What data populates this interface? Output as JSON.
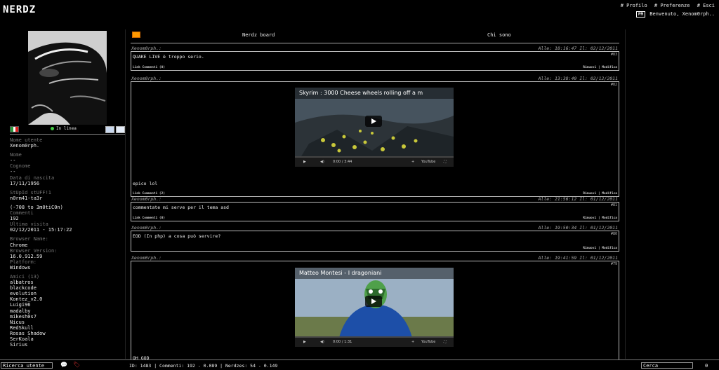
{
  "app": {
    "logo": "NERDZ"
  },
  "topnav": {
    "profilo": "# Profilo",
    "preferenze": "# Preferenze",
    "esci": "# Esci"
  },
  "welcome": {
    "pm_icon": "PM",
    "text": "Benvenuto, Xenom0rph.."
  },
  "sidebar": {
    "online": "In linea",
    "fields": [
      {
        "label": "Nome utente",
        "value": "Xenom0rph."
      },
      {
        "label": "Nome",
        "value": "--"
      },
      {
        "label": "Cognome",
        "value": "--"
      },
      {
        "label": "Data di nascita",
        "value": "17/11/1956"
      },
      {
        "label": "StUpId stUFF!1",
        "value": "n0rm41-ta3r"
      },
      {
        "label": "",
        "value": "(-708 to 3m0tiC0n)"
      },
      {
        "label": "Commenti",
        "value": "192"
      },
      {
        "label": "Ultima visita",
        "value": "02/12/2011 - 15:17:22"
      },
      {
        "label": "Browser Name:",
        "value": "Chrome"
      },
      {
        "label": "Browser Version:",
        "value": "16.0.912.59"
      },
      {
        "label": "Platform:",
        "value": "Windows"
      }
    ],
    "friends_label": "Amici (13)",
    "friends": [
      "albatros",
      "blackcode",
      "evolution",
      "Kontez_v2.0",
      "Luigi96",
      "madalby",
      "mikesh0s7",
      "Nicus",
      "RedSkull",
      "Rosas Shadow",
      "SerKoala",
      "Sirius"
    ]
  },
  "tabs": {
    "board": "Nerdz board",
    "chisono": "Chi sono"
  },
  "posts": [
    {
      "author": "Xenom0rph.:",
      "date": "Alle: 18:16:47   Il: 02/12/2011",
      "num": "#83",
      "text": "QUAKE LIVE è troppo serio.",
      "link": "Link  Commenti (0)",
      "actions": "Rimuovi | Modifica"
    },
    {
      "author": "Xenom0rph.:",
      "date": "Alle: 13:38:40   Il: 02/12/2011",
      "num": "#82",
      "text": "epico lol",
      "link": "Link  Commenti (2)",
      "actions": "Rimuovi | Modifica",
      "video_title": "Skyrim : 3000 Cheese wheels rolling off a m",
      "video_time": "0:00 / 3:44"
    },
    {
      "author": "Xenom0rph.:",
      "date": "Alle: 21:56:12   Il: 01/12/2011",
      "num": "#81",
      "text": "commentate mi serve per il tema asd",
      "link": "Link  Commenti (0)",
      "actions": "Rimuovi | Modifica"
    },
    {
      "author": "Xenom0rph.:",
      "date": "Alle: 19:50:34   Il: 01/12/2011",
      "num": "#80",
      "text": "EOD (In php) a cosa può servire?",
      "link": "",
      "actions": "Rimuovi | Modifica"
    },
    {
      "author": "Xenom0rph.:",
      "date": "Alle: 19:41:59   Il: 01/12/2011",
      "num": "#79",
      "text": "OH GOD",
      "video_title": "Matteo Montesi - I dragoniani",
      "video_time": "0:00 / 1:31"
    }
  ],
  "video_ui": {
    "youtube": "YouTube"
  },
  "bottom": {
    "search_value": "Ricerca utente",
    "stats": "ID: 1483 | Commenti: 192 - 0.089 | Nerdzes: 54 - 0.149",
    "cerca_value": "Cerca",
    "count": "0"
  },
  "colors": {
    "accent_rss": "#ff9900",
    "online": "#44cc44"
  }
}
